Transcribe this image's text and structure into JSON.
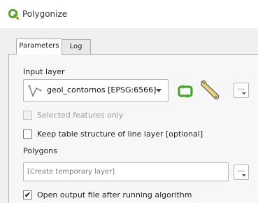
{
  "window": {
    "title": "Polygonize",
    "icon": "qgis-logo-icon"
  },
  "tabs": [
    {
      "label": "Parameters",
      "active": true
    },
    {
      "label": "Log",
      "active": false
    }
  ],
  "input_layer": {
    "label": "Input layer",
    "selected": "geol_contornos [EPSG:6566]",
    "layer_type_icon": "line-layer-icon",
    "iterate_icon": "iterate-features-icon",
    "advanced_icon": "wrench-icon",
    "options_button": "..."
  },
  "selected_only": {
    "label": "Selected features only",
    "checked": false,
    "enabled": false
  },
  "keep_table": {
    "label": "Keep table structure of line layer [optional]",
    "checked": false,
    "enabled": true
  },
  "polygons": {
    "label": "Polygons",
    "placeholder": "[Create temporary layer]",
    "value": "",
    "button": "..."
  },
  "open_output": {
    "label": "Open output file after running algorithm",
    "checked": true,
    "mark": "✔"
  },
  "colors": {
    "accent_green": "#5aa433",
    "iterate_green": "#4ca22f"
  }
}
